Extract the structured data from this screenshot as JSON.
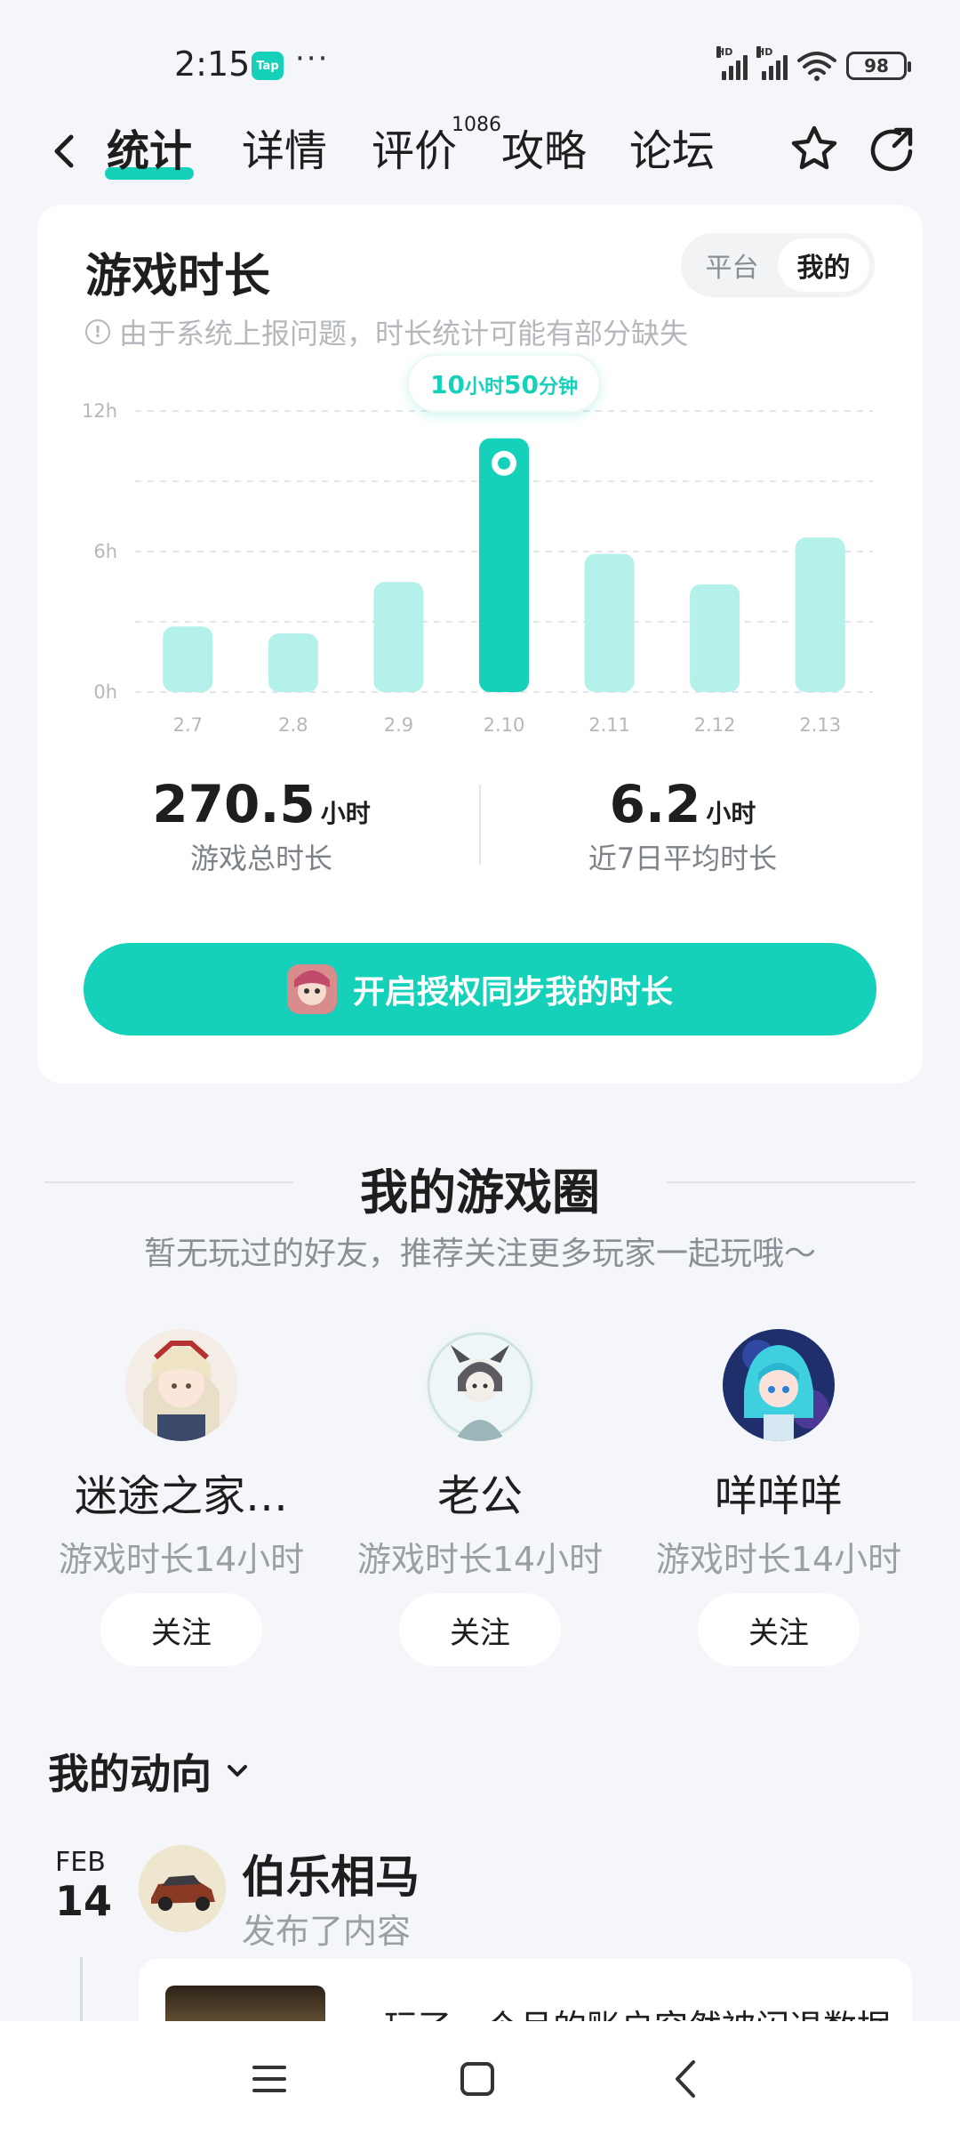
{
  "status_bar": {
    "time": "2:15",
    "app_badge": "Tap",
    "dots": "···",
    "network1": "HD",
    "network2": "HD",
    "battery": "98"
  },
  "nav": {
    "tabs": [
      {
        "label": "统计",
        "active": true
      },
      {
        "label": "详情",
        "active": false
      },
      {
        "label": "评价",
        "active": false
      },
      {
        "label": "攻略",
        "active": false
      },
      {
        "label": "论坛",
        "active": false
      }
    ],
    "review_count": "1086"
  },
  "playtime": {
    "title": "游戏时长",
    "toggle": {
      "options": [
        "平台",
        "我的"
      ],
      "selected": "我的"
    },
    "notice": "由于系统上报问题，时长统计可能有部分缺失",
    "tooltip": {
      "hours": "10",
      "hours_unit": "小时",
      "minutes": "50",
      "minutes_unit": "分钟"
    },
    "total": {
      "value": "270.5",
      "unit": "小时",
      "label": "游戏总时长"
    },
    "average": {
      "value": "6.2",
      "unit": "小时",
      "label": "近7日平均时长"
    },
    "sync_button": "开启授权同步我的时长"
  },
  "chart_data": {
    "type": "bar",
    "categories": [
      "2.7",
      "2.8",
      "2.9",
      "2.10",
      "2.11",
      "2.12",
      "2.13"
    ],
    "values": [
      2.8,
      2.5,
      4.7,
      10.83,
      5.9,
      4.6,
      6.6
    ],
    "highlight_index": 3,
    "yticks": [
      "12h",
      "6h",
      "0h"
    ],
    "ylim": [
      0,
      12
    ],
    "grid": true,
    "colors": {
      "bar": "#b3f1ea",
      "highlight": "#15d1b9"
    }
  },
  "game_circle": {
    "title": "我的游戏圈",
    "subtitle": "暂无玩过的好友，推荐关注更多玩家一起玩哦～",
    "friends": [
      {
        "name": "迷途之家…",
        "playtime": "游戏时长14小时",
        "follow": "关注"
      },
      {
        "name": "老公",
        "playtime": "游戏时长14小时",
        "follow": "关注"
      },
      {
        "name": "咩咩咩",
        "playtime": "游戏时长14小时",
        "follow": "关注"
      }
    ]
  },
  "activity": {
    "title": "我的动向",
    "month": "FEB",
    "day": "14",
    "user": "伯乐相马",
    "desc": "发布了内容",
    "post_text": "玩了一个月的账户突然被闪退数据"
  },
  "colors": {
    "accent": "#15d1b9",
    "background": "#f4f6f9"
  }
}
